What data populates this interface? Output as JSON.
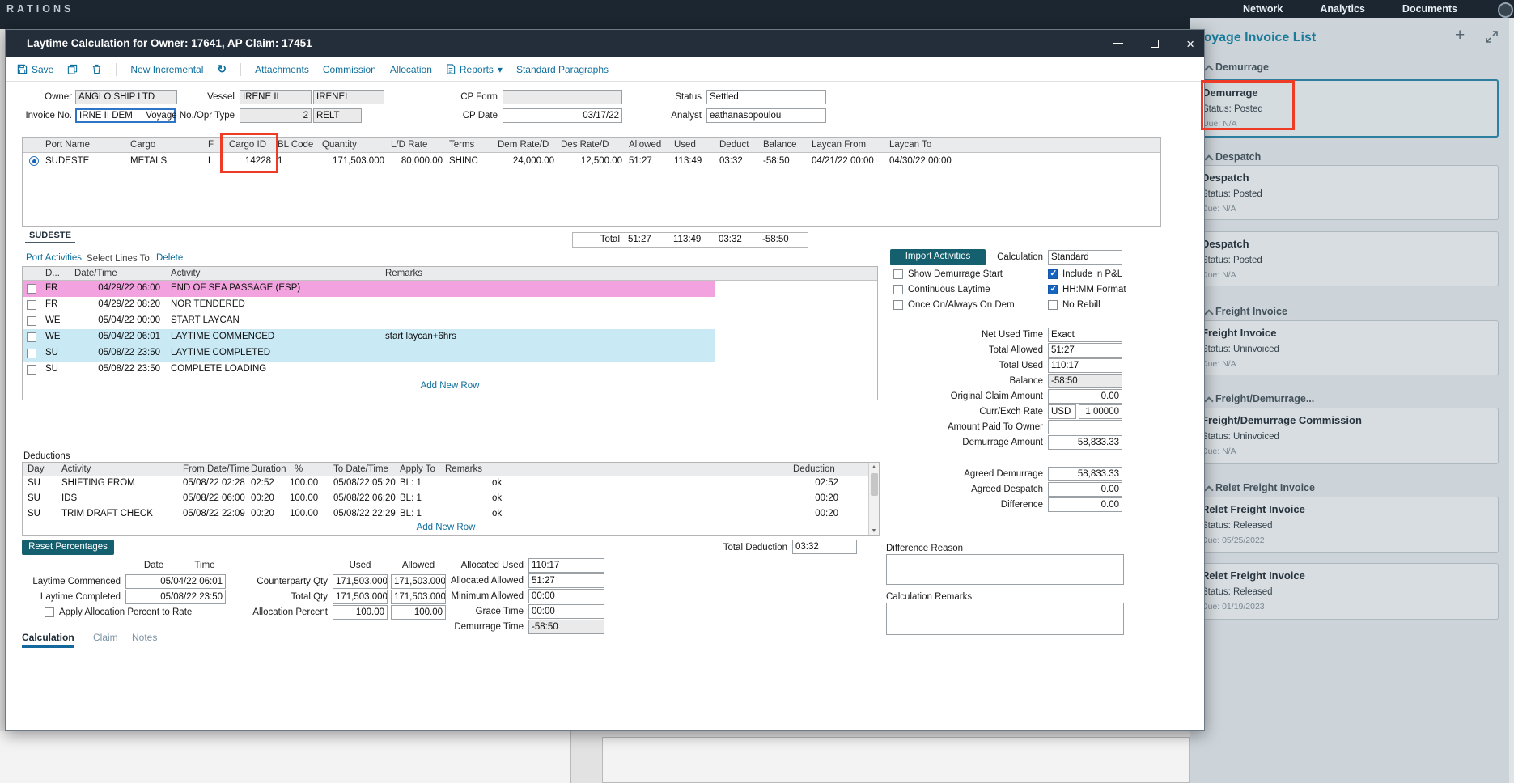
{
  "topbar": {
    "brand": "RATIONS",
    "nav": [
      "Network",
      "Analytics",
      "Documents"
    ]
  },
  "dialog": {
    "title": "Laytime Calculation for Owner: 17641, AP Claim: 17451",
    "toolbar": {
      "save": "Save",
      "new_incremental": "New Incremental",
      "attachments": "Attachments",
      "commission": "Commission",
      "allocation": "Allocation",
      "reports": "Reports",
      "standard_paragraphs": "Standard Paragraphs"
    },
    "header_form": {
      "owner": {
        "label": "Owner",
        "value": "ANGLO SHIP LTD"
      },
      "invoice_no": {
        "label": "Invoice No.",
        "value": "IRNE II DEM"
      },
      "vessel": {
        "label": "Vessel",
        "name": "IRENE II",
        "code": "IRENEI"
      },
      "voyage": {
        "label": "Voyage No./Opr Type",
        "no": "2",
        "opr": "RELT"
      },
      "cp_form": {
        "label": "CP Form",
        "value": ""
      },
      "cp_date": {
        "label": "CP Date",
        "value": "03/17/22"
      },
      "status": {
        "label": "Status",
        "value": "Settled"
      },
      "analyst": {
        "label": "Analyst",
        "value": "eathanasopoulou"
      }
    },
    "cargo_table": {
      "columns": [
        "Port Name",
        "Cargo",
        "F",
        "Cargo ID",
        "BL Code",
        "Quantity",
        "L/D Rate",
        "Terms",
        "Dem Rate/D",
        "Des Rate/D",
        "Allowed",
        "Used",
        "Deduct",
        "Balance",
        "Laycan From",
        "Laycan To"
      ],
      "row": {
        "port": "SUDESTE",
        "cargo": "METALS",
        "f": "L",
        "cargo_id": "14228",
        "bl": "1",
        "qty": "171,503.000",
        "ld_rate": "80,000.00",
        "terms": "SHINC",
        "dem": "24,000.00",
        "des": "12,500.00",
        "allowed": "51:27",
        "used": "113:49",
        "deduct": "03:32",
        "balance": "-58:50",
        "laycan_from": "04/21/22 00:00",
        "laycan_to": "04/30/22 00:00"
      },
      "total": {
        "label": "Total",
        "allowed": "51:27",
        "used": "113:49",
        "deduct": "03:32",
        "balance": "-58:50"
      }
    },
    "port_tab": "SUDESTE",
    "activities": {
      "port_activities_link": "Port Activities",
      "select_lines_link": "Select Lines To",
      "delete_link": "Delete",
      "columns": [
        "D...",
        "Date/Time",
        "Activity",
        "Remarks"
      ],
      "rows": [
        {
          "day": "FR",
          "dt": "04/29/22 06:00",
          "activity": "END OF SEA PASSAGE (ESP)",
          "remarks": "",
          "highlight": "pink"
        },
        {
          "day": "FR",
          "dt": "04/29/22 08:20",
          "activity": "NOR TENDERED",
          "remarks": "",
          "highlight": ""
        },
        {
          "day": "WE",
          "dt": "05/04/22 00:00",
          "activity": "START LAYCAN",
          "remarks": "",
          "highlight": ""
        },
        {
          "day": "WE",
          "dt": "05/04/22 06:01",
          "activity": "LAYTIME COMMENCED",
          "remarks": "start laycan+6hrs",
          "highlight": "blue"
        },
        {
          "day": "SU",
          "dt": "05/08/22 23:50",
          "activity": "LAYTIME COMPLETED",
          "remarks": "",
          "highlight": "blue"
        },
        {
          "day": "SU",
          "dt": "05/08/22 23:50",
          "activity": "COMPLETE LOADING",
          "remarks": "",
          "highlight": ""
        }
      ],
      "add_new_row": "Add New Row"
    },
    "calc_panel": {
      "import_activities": "Import Activities",
      "calculation_label": "Calculation",
      "calculation_value": "Standard",
      "checks_left": [
        {
          "label": "Show Demurrage Start",
          "checked": false
        },
        {
          "label": "Continuous Laytime",
          "checked": false
        },
        {
          "label": "Once On/Always On Dem",
          "checked": false
        }
      ],
      "checks_right": [
        {
          "label": "Include in P&L",
          "checked": true
        },
        {
          "label": "HH:MM Format",
          "checked": true
        },
        {
          "label": "No Rebill",
          "checked": false
        }
      ],
      "net_used_time": {
        "label": "Net Used Time",
        "value": "Exact"
      },
      "total_allowed": {
        "label": "Total Allowed",
        "value": "51:27"
      },
      "total_used": {
        "label": "Total Used",
        "value": "110:17"
      },
      "balance": {
        "label": "Balance",
        "value": "-58:50"
      },
      "original_claim": {
        "label": "Original Claim Amount",
        "value": "0.00"
      },
      "curr_exch": {
        "label": "Curr/Exch Rate",
        "currency": "USD",
        "rate": "1.00000"
      },
      "amount_paid": {
        "label": "Amount Paid To Owner",
        "value": ""
      },
      "demurrage_amount": {
        "label": "Demurrage Amount",
        "value": "58,833.33"
      },
      "agreed_demurrage": {
        "label": "Agreed Demurrage",
        "value": "58,833.33"
      },
      "agreed_despatch": {
        "label": "Agreed Despatch",
        "value": "0.00"
      },
      "difference": {
        "label": "Difference",
        "value": "0.00"
      }
    },
    "deductions": {
      "label": "Deductions",
      "columns": [
        "Day",
        "Activity",
        "From Date/Time",
        "Duration",
        "%",
        "To Date/Time",
        "Apply To",
        "Remarks",
        "Deduction"
      ],
      "rows": [
        {
          "day": "SU",
          "activity": "SHIFTING FROM",
          "from": "05/08/22 02:28",
          "duration": "02:52",
          "pct": "100.00",
          "to": "05/08/22 05:20",
          "apply": "BL: 1",
          "remarks": "ok",
          "deduction": "02:52"
        },
        {
          "day": "SU",
          "activity": "IDS",
          "from": "05/08/22 06:00",
          "duration": "00:20",
          "pct": "100.00",
          "to": "05/08/22 06:20",
          "apply": "BL: 1",
          "remarks": "ok",
          "deduction": "00:20"
        },
        {
          "day": "SU",
          "activity": "TRIM DRAFT CHECK",
          "from": "05/08/22 22:09",
          "duration": "00:20",
          "pct": "100.00",
          "to": "05/08/22 22:29",
          "apply": "BL: 1",
          "remarks": "ok",
          "deduction": "00:20"
        }
      ],
      "add_new_row": "Add New Row",
      "total_label": "Total Deduction",
      "total_value": "03:32"
    },
    "allocation": {
      "reset_btn": "Reset Percentages",
      "date_hdr": "Date",
      "time_hdr": "Time",
      "used_hdr": "Used",
      "allowed_hdr": "Allowed",
      "laytime_commenced": {
        "label": "Laytime Commenced",
        "value": "05/04/22 06:01"
      },
      "laytime_completed": {
        "label": "Laytime Completed",
        "value": "05/08/22 23:50"
      },
      "apply_allocation": {
        "label": "Apply Allocation Percent to Rate",
        "checked": false
      },
      "counterparty_qty": {
        "label": "Counterparty Qty",
        "used": "171,503.000",
        "allowed": "171,503.000"
      },
      "total_qty": {
        "label": "Total Qty",
        "used": "171,503.000",
        "allowed": "171,503.000"
      },
      "allocation_percent": {
        "label": "Allocation Percent",
        "used": "100.00",
        "allowed": "100.00"
      },
      "allocated_used": {
        "label": "Allocated Used",
        "value": "110:17"
      },
      "allocated_allowed": {
        "label": "Allocated Allowed",
        "value": "51:27"
      },
      "minimum_allowed": {
        "label": "Minimum Allowed",
        "value": "00:00"
      },
      "grace_time": {
        "label": "Grace Time",
        "value": "00:00"
      },
      "demurrage_time": {
        "label": "Demurrage Time",
        "value": "-58:50"
      },
      "difference_reason": {
        "label": "Difference Reason",
        "value": ""
      },
      "calculation_remarks": {
        "label": "Calculation Remarks",
        "value": ""
      }
    },
    "tabs": [
      {
        "label": "Calculation",
        "active": true
      },
      {
        "label": "Claim",
        "active": false
      },
      {
        "label": "Notes",
        "active": false
      }
    ]
  },
  "sidebar": {
    "title": "Voyage Invoice List",
    "sections": [
      {
        "label": "Demurrage",
        "cards": [
          {
            "title": "Demurrage",
            "status": "Status: Posted",
            "due": "Due: N/A",
            "selected": true
          }
        ]
      },
      {
        "label": "Despatch",
        "cards": [
          {
            "title": "Despatch",
            "status": "Status: Posted",
            "due": "Due: N/A"
          },
          {
            "title": "Despatch",
            "status": "Status: Posted",
            "due": "Due: N/A"
          }
        ]
      },
      {
        "label": "Freight Invoice",
        "cards": [
          {
            "title": "Freight Invoice",
            "status": "Status: Uninvoiced",
            "due": "Due: N/A"
          }
        ]
      },
      {
        "label": "Freight/Demurrage...",
        "cards": [
          {
            "title": "Freight/Demurrage Commission",
            "status": "Status: Uninvoiced",
            "due": "Due: N/A"
          }
        ]
      },
      {
        "label": "Relet Freight Invoice",
        "cards": [
          {
            "title": "Relet Freight Invoice",
            "status": "Status: Released",
            "due": "Due: 05/25/2022"
          },
          {
            "title": "Relet Freight Invoice",
            "status": "Status: Released",
            "due": "Due: 01/19/2023"
          }
        ]
      }
    ]
  },
  "colors": {
    "annotation": "#ee3b25",
    "accent_teal": "#0e6f9d",
    "button_teal": "#15606e",
    "selected_card_border": "#2d7fa0",
    "row_pink": "#f2a2de",
    "row_blue": "#c9e9f5"
  }
}
